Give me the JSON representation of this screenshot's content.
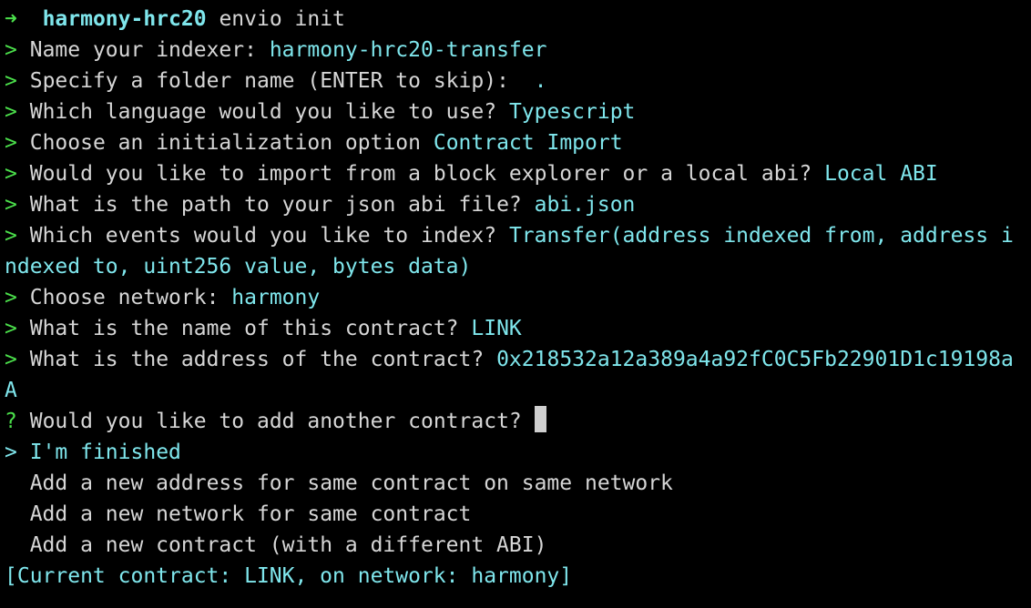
{
  "prompt": {
    "arrow": "➜",
    "dir": "harmony-hrc20",
    "command": "envio init"
  },
  "markers": {
    "done": ">",
    "question": "?",
    "selected": ">"
  },
  "qa": [
    {
      "q": "Name your indexer:",
      "a": "harmony-hrc20-transfer"
    },
    {
      "q": "Specify a folder name (ENTER to skip):",
      "a": "."
    },
    {
      "q": "Which language would you like to use?",
      "a": "Typescript"
    },
    {
      "q": "Choose an initialization option",
      "a": "Contract Import"
    },
    {
      "q": "Would you like to import from a block explorer or a local abi?",
      "a": "Local ABI"
    },
    {
      "q": "What is the path to your json abi file?",
      "a": "abi.json"
    },
    {
      "q": "Which events would you like to index?",
      "a": "Transfer(address indexed from, address i",
      "a_wrap": "ndexed to, uint256 value, bytes data)"
    },
    {
      "q": "Choose network:",
      "a": "harmony"
    },
    {
      "q": "What is the name of this contract?",
      "a": "LINK"
    },
    {
      "q": "What is the address of the contract?",
      "a": "0x218532a12a389a4a92fC0C5Fb22901D1c19198a",
      "a_wrap": "A"
    }
  ],
  "current_question": "Would you like to add another contract?",
  "options": [
    "I'm finished",
    "Add a new address for same contract on same network",
    "Add a new network for same contract",
    "Add a new contract (with a different ABI)"
  ],
  "selected_option_index": 0,
  "status_line": "[Current contract: LINK, on network: harmony]",
  "colors": {
    "background": "#000000",
    "prompt_arrow": "#4be04b",
    "accent_cyan": "#7fe6ec",
    "text": "#d6d6d6",
    "cursor": "#cfcfcf"
  }
}
